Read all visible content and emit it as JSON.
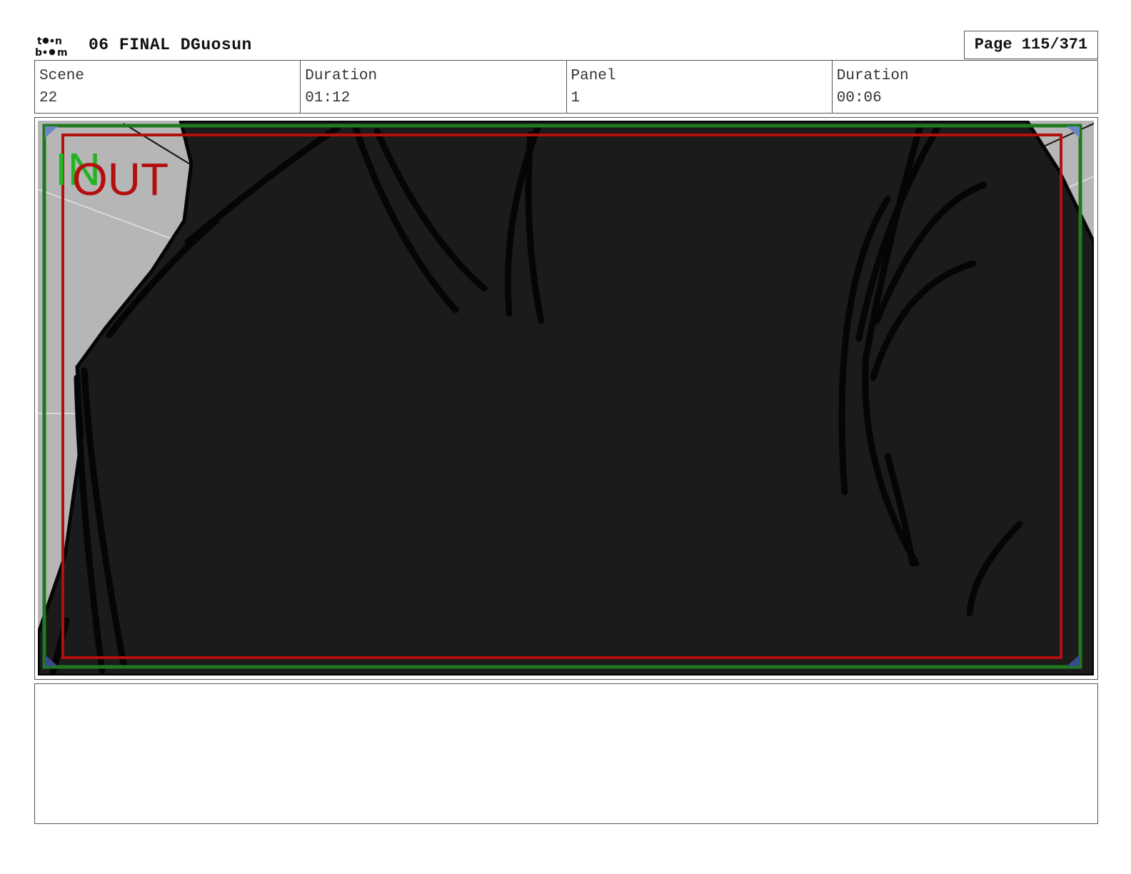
{
  "header": {
    "logo_icon": "toonboom-logo-icon",
    "project_title": "06 FINAL DGuosun",
    "page": "Page 115/371"
  },
  "info": {
    "scene_label": "Scene",
    "scene_value": "22",
    "scene_duration_label": "Duration",
    "scene_duration_value": "01:12",
    "panel_label": "Panel",
    "panel_value": "1",
    "panel_duration_label": "Duration",
    "panel_duration_value": "00:06"
  },
  "panel": {
    "in_marker": "IN",
    "out_marker": "OUT",
    "colors": {
      "in_frame": "#1f7a1f",
      "in_text": "#22b422",
      "out_frame": "#b40f0f",
      "fill_dark": "#1b1b1b",
      "background_gray": "#b6b6b6"
    }
  },
  "notes": {
    "text": ""
  }
}
